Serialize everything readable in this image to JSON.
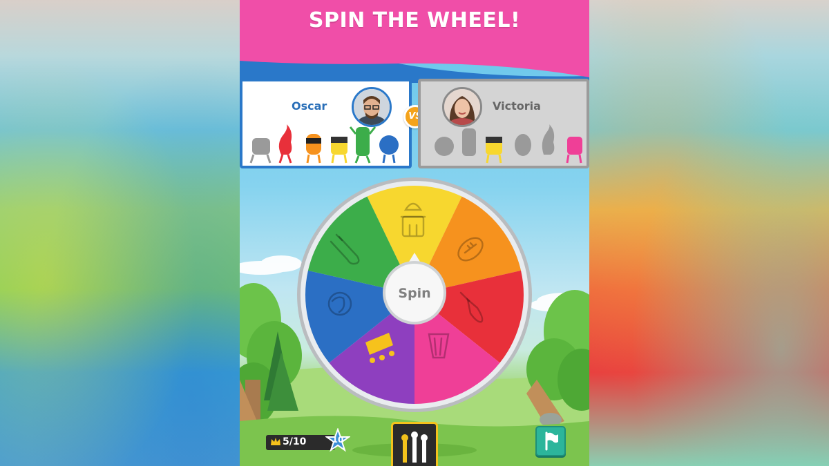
{
  "banner": {
    "title": "SPIN THE WHEEL!",
    "color": "#f04ea8"
  },
  "players": [
    {
      "name": "Oscar",
      "active": true
    },
    {
      "name": "Victoria",
      "active": false
    }
  ],
  "vs_label": "VS",
  "wheel": {
    "center_label": "Spin",
    "segments": [
      {
        "category": "entertainment",
        "color": "#f7d72f",
        "icon": "tower-icon"
      },
      {
        "category": "sports",
        "color": "#f6921e",
        "icon": "football-icon"
      },
      {
        "category": "art",
        "color": "#e8303a",
        "icon": "paintbrush-icon"
      },
      {
        "category": "pop-culture",
        "color": "#ef3f97",
        "icon": "popcorn-icon"
      },
      {
        "category": "crown",
        "color": "#8e3fbf",
        "icon": "crown-icon"
      },
      {
        "category": "geography",
        "color": "#2b6fc4",
        "icon": "globe-icon"
      },
      {
        "category": "science",
        "color": "#3cad4a",
        "icon": "test-tube-icon"
      }
    ]
  },
  "status": {
    "crowns": "5/10",
    "stars": "10"
  },
  "colors": {
    "accent_blue": "#2a78c9",
    "vs_orange": "#f4a31b",
    "flag_teal": "#2cb59b"
  }
}
